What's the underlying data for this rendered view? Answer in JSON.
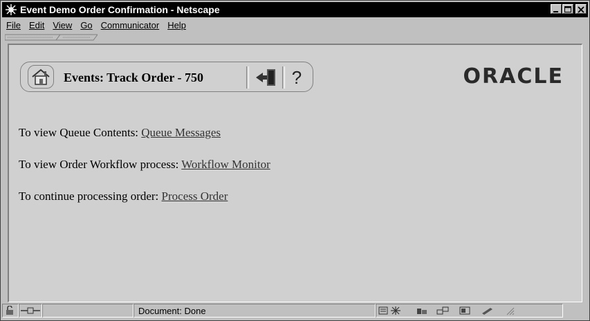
{
  "window": {
    "title": "Event Demo Order Confirmation - Netscape"
  },
  "menu": {
    "items": [
      {
        "label": "File"
      },
      {
        "label": "Edit"
      },
      {
        "label": "View"
      },
      {
        "label": "Go"
      },
      {
        "label": "Communicator"
      },
      {
        "label": "Help"
      }
    ]
  },
  "banner": {
    "title": "Events: Track Order - 750",
    "help_symbol": "?",
    "home_icon": "home-icon",
    "exit_icon": "exit-door-icon"
  },
  "brand": {
    "logo_text": "ORACLE"
  },
  "links": [
    {
      "prefix": "To view Queue Contents: ",
      "link": "Queue Messages"
    },
    {
      "prefix": "To view Order Workflow process: ",
      "link": "Workflow Monitor"
    },
    {
      "prefix": "To continue processing order: ",
      "link": "Process Order"
    }
  ],
  "status": {
    "text": "Document: Done"
  }
}
